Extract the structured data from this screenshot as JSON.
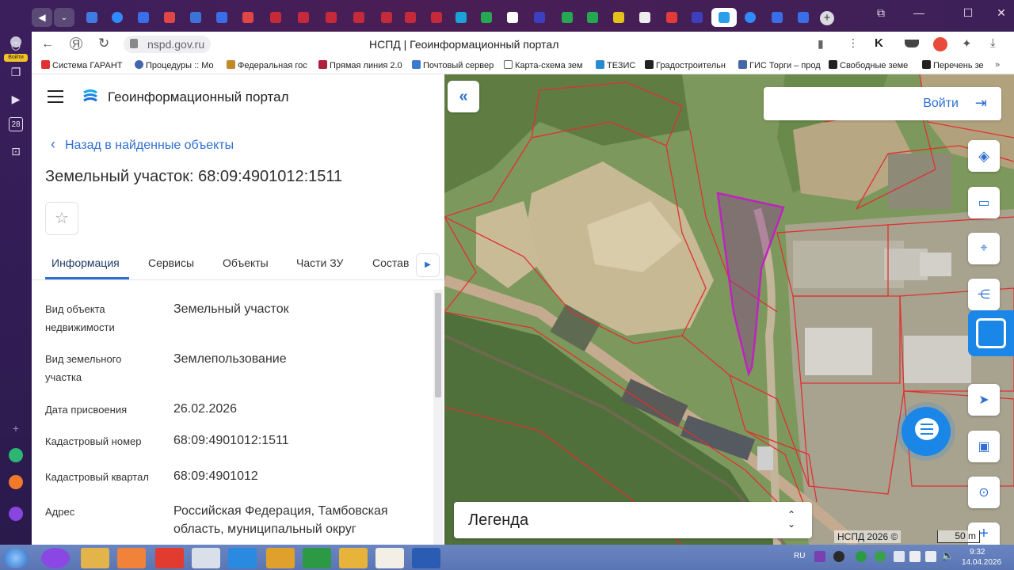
{
  "browser": {
    "address": "nspd.gov.ru",
    "page_title": "НСПД | Геоинформационный портал",
    "profile_label": "Войти",
    "rail_day": "28"
  },
  "bookmarks": [
    "Система ГАРАНТ",
    "Процедуры :: Мо",
    "Федеральная гос",
    "Прямая линия 2.0",
    "Почтовый сервер",
    "Карта-схема зем",
    "ТЕЗИС",
    "Градостроительн",
    "ГИС Торги – прод",
    "Свободные земе",
    "Перечень зе"
  ],
  "panel": {
    "portal_name": "Геоинформационный портал",
    "back_label": "Назад в найденные объекты",
    "object_title": "Земельный участок: 68:09:4901012:1511",
    "tabs": [
      "Информация",
      "Сервисы",
      "Объекты",
      "Части ЗУ",
      "Состав"
    ],
    "rows": [
      {
        "label": "Вид объекта недвижимости",
        "value": "Земельный участок"
      },
      {
        "label": "Вид земельного участка",
        "value": "Землепользование"
      },
      {
        "label": "Дата присвоения",
        "value": "26.02.2026"
      },
      {
        "label": "Кадастровый номер",
        "value": "68:09:4901012:1511"
      },
      {
        "label": "Кадастровый квартал",
        "value": "68:09:4901012"
      },
      {
        "label": "Адрес",
        "value": "Российская Федерация, Тамбовская область, муниципальный округ"
      }
    ]
  },
  "map": {
    "login_label": "Войти",
    "legend_label": "Легенда",
    "attribution": "НСПД 2026 ©",
    "scale_label": "50 m"
  },
  "taskbar": {
    "lang": "RU",
    "time": "9:32",
    "date": "14.04.2026"
  },
  "colors": {
    "accent": "#2f6fd1",
    "parcel_outline": "#e03030",
    "selected_parcel": "#b020b0",
    "chat_blue": "#1a86e8"
  }
}
